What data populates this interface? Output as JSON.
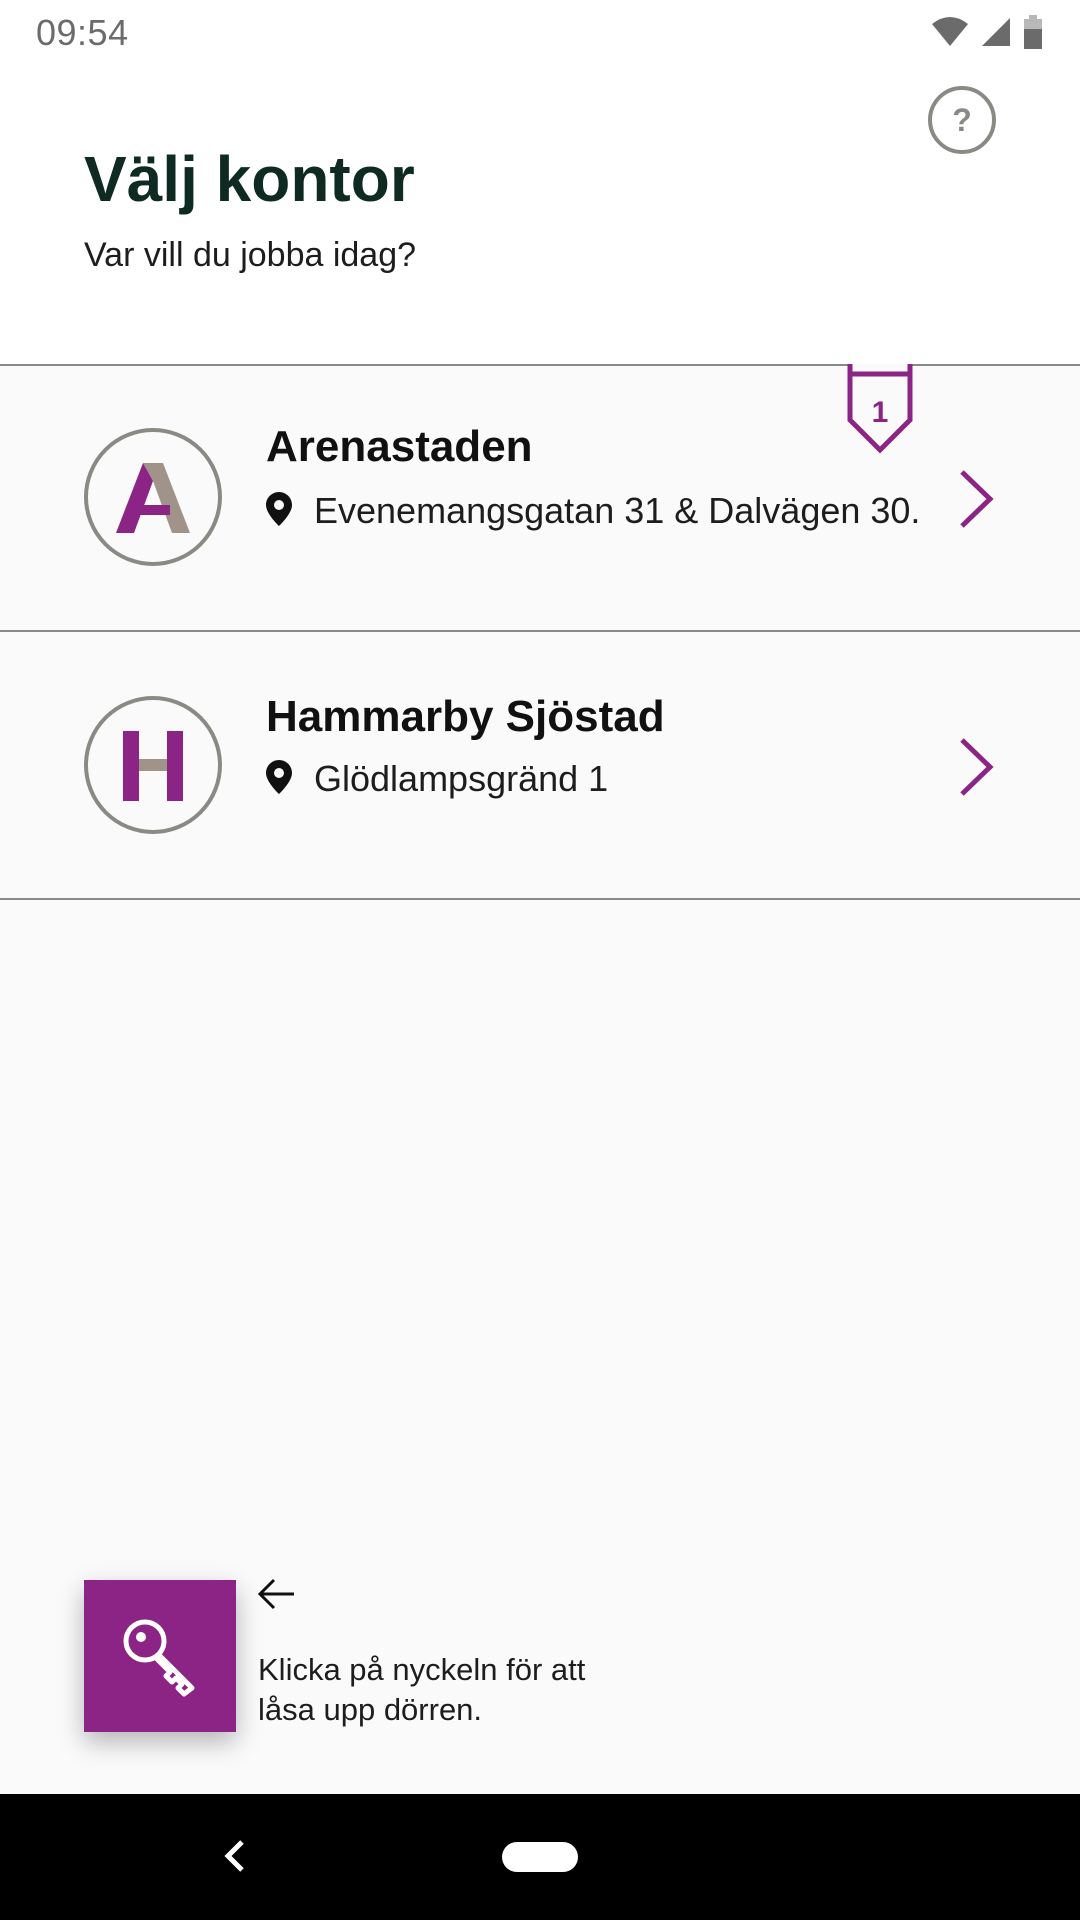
{
  "status_bar": {
    "time": "09:54",
    "icons": [
      "wifi-icon",
      "cellular-signal-icon",
      "battery-icon"
    ]
  },
  "header": {
    "title": "Välj kontor",
    "subtitle": "Var vill du jobba idag?",
    "help_icon": "question-mark-icon",
    "help_label": "?"
  },
  "offices": [
    {
      "letter": "A",
      "name": "Arenastaden",
      "address": "Evenemangsgatan 31 & Dalvägen 30.",
      "badge_count": "1"
    },
    {
      "letter": "H",
      "name": "Hammarby Sjöstad",
      "address": "Glödlampsgränd 1"
    }
  ],
  "unlock": {
    "icon": "key-icon",
    "hint": "Klicka på nyckeln för att låsa upp dörren."
  },
  "nav_bar": {
    "icons": [
      "back-icon",
      "home-pill-icon"
    ]
  },
  "colors": {
    "accent": "#8b2485",
    "title": "#0f2a22",
    "divider": "#8a8a84",
    "letter_secondary": "#a0938a"
  }
}
